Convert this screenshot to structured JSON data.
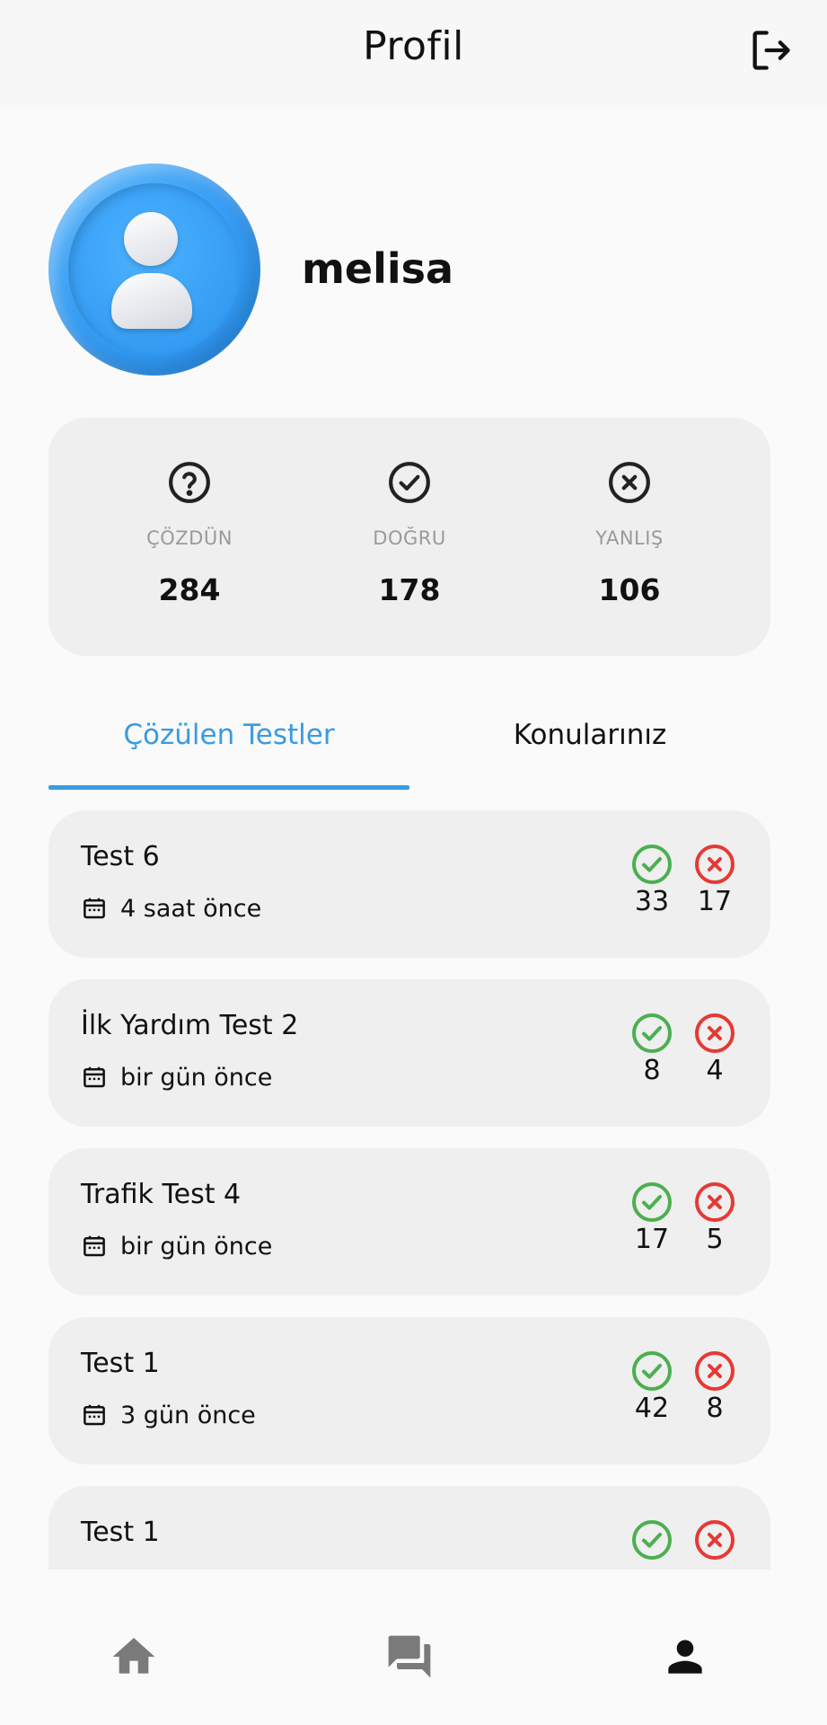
{
  "header": {
    "title": "Profil",
    "logout_icon": "logout-icon"
  },
  "profile": {
    "username": "melisa",
    "avatar_icon": "user-avatar"
  },
  "stats": [
    {
      "label": "ÇÖZDÜN",
      "value": "284",
      "icon": "question-circle-icon"
    },
    {
      "label": "DOĞRU",
      "value": "178",
      "icon": "check-circle-icon"
    },
    {
      "label": "YANLIŞ",
      "value": "106",
      "icon": "x-circle-icon"
    }
  ],
  "tabs": [
    {
      "label": "Çözülen Testler",
      "active": true
    },
    {
      "label": "Konularınız",
      "active": false
    }
  ],
  "tests": [
    {
      "name": "Test 6",
      "date": "4 saat önce",
      "correct": "33",
      "wrong": "17"
    },
    {
      "name": "İlk Yardım Test 2",
      "date": "bir gün önce",
      "correct": "8",
      "wrong": "4"
    },
    {
      "name": "Trafik Test 4",
      "date": "bir gün önce",
      "correct": "17",
      "wrong": "5"
    },
    {
      "name": "Test 1",
      "date": "3 gün önce",
      "correct": "42",
      "wrong": "8"
    },
    {
      "name": "Test 1",
      "date": "",
      "correct": "",
      "wrong": ""
    }
  ],
  "colors": {
    "accent": "#3a9be0",
    "correct": "#4caf50",
    "wrong": "#e53935"
  },
  "nav": [
    {
      "icon": "home-icon",
      "active": false
    },
    {
      "icon": "forum-icon",
      "active": false
    },
    {
      "icon": "person-icon",
      "active": true
    }
  ]
}
